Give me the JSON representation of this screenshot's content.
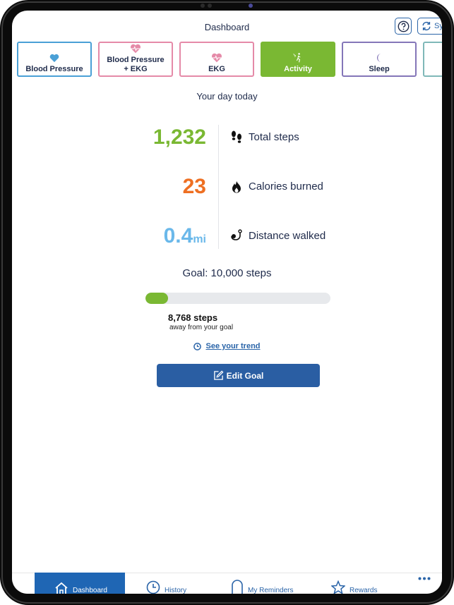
{
  "header": {
    "title": "Dashboard",
    "help_icon": "question-icon",
    "sync_label": "Sync",
    "sync_icon": "refresh-icon"
  },
  "tabs": [
    {
      "label": "Blood Pressure",
      "icon": "heart-icon",
      "color": "#4aa0d6",
      "active": false
    },
    {
      "label": "Blood Pressure + EKG",
      "line1": "Blood Pressure",
      "line2": "+ EKG",
      "icon": "heart-pulse-icon",
      "color": "#e58aa8",
      "active": false
    },
    {
      "label": "EKG",
      "icon": "heart-pulse-icon",
      "color": "#e58aa8",
      "active": false
    },
    {
      "label": "Activity",
      "icon": "activity-icon",
      "color": "#7ab833",
      "active": true
    },
    {
      "label": "Sleep",
      "icon": "moon-icon",
      "color": "#8476b8",
      "active": false
    }
  ],
  "main": {
    "subtitle": "Your day today",
    "stats": [
      {
        "value": "1,232",
        "unit": "",
        "label": "Total steps",
        "icon": "footprints-icon",
        "color": "#7ab833"
      },
      {
        "value": "23",
        "unit": "",
        "label": "Calories burned",
        "icon": "flame-icon",
        "color": "#ee6f22"
      },
      {
        "value": "0.4",
        "unit": "mi",
        "label": "Distance walked",
        "icon": "route-icon",
        "color": "#6ab8ea"
      }
    ],
    "goal_title": "Goal: 10,000 steps",
    "goal_progress_fraction": 0.1232,
    "remaining_steps": "8,768 steps",
    "remaining_sub": "away from your goal",
    "trend_link": "See your trend",
    "edit_goal": "Edit Goal"
  },
  "bottom_nav": [
    {
      "label": "Dashboard",
      "icon": "home-icon",
      "active": true
    },
    {
      "label": "History",
      "icon": "clock-icon",
      "active": false
    },
    {
      "label": "My Reminders",
      "icon": "bell-icon",
      "active": false
    },
    {
      "label": "Rewards",
      "icon": "star-icon",
      "active": false
    },
    {
      "label": "More",
      "icon": "more-dots-icon",
      "active": false
    }
  ],
  "colors": {
    "accent_blue": "#2a5ea3",
    "activity_green": "#7ab833"
  }
}
